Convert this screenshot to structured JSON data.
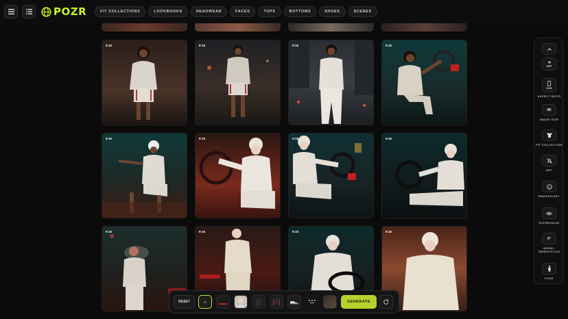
{
  "app": {
    "brand": "POZR"
  },
  "nav": [
    "FIT COLLECTIONS",
    "LOOKBOOKS",
    "HEADWEAR",
    "FACES",
    "TOPS",
    "BOTTOMS",
    "SHOES",
    "SCENES"
  ],
  "grid": {
    "ratio_label": "9:16",
    "tiles": [
      {
        "scene": "standing-hoodie-shorts-street-night"
      },
      {
        "scene": "standing-hoodie-shorts-neon-street"
      },
      {
        "scene": "standing-hoodie-pants-city-night"
      },
      {
        "scene": "seated-driver-car-interior"
      },
      {
        "scene": "seated-beanie-car-door"
      },
      {
        "scene": "seated-beanie-red-car-interior"
      },
      {
        "scene": "seated-beanie-steering-wheel"
      },
      {
        "scene": "seated-beanie-car-dark"
      },
      {
        "scene": "back-view-street-night"
      },
      {
        "scene": "standing-phone-red-light"
      },
      {
        "scene": "driver-steering-wheel"
      },
      {
        "scene": "seated-hood-warm-light"
      }
    ]
  },
  "side_panel": {
    "items": [
      {
        "value": "OPT",
        "label": ""
      },
      {
        "value": "9:16",
        "label": "ASPECT RATIO"
      },
      {
        "value": "4K",
        "label": "IMAGE SIZE"
      },
      {
        "value": "",
        "label": "FIT COLLECTION"
      },
      {
        "value": "",
        "label": "OFF"
      },
      {
        "value": "",
        "label": "MAKEUP/ART"
      },
      {
        "value": "",
        "label": "EXPRESSION"
      },
      {
        "value": "0°",
        "label": "MODEL ORIENTATION"
      },
      {
        "value": "",
        "label": "POSE"
      }
    ]
  },
  "bottom_bar": {
    "reset_label": "RESET",
    "generate_label": "GENERATE"
  },
  "colors": {
    "accent": "#c8f02a",
    "generate": "#b6d12c"
  }
}
